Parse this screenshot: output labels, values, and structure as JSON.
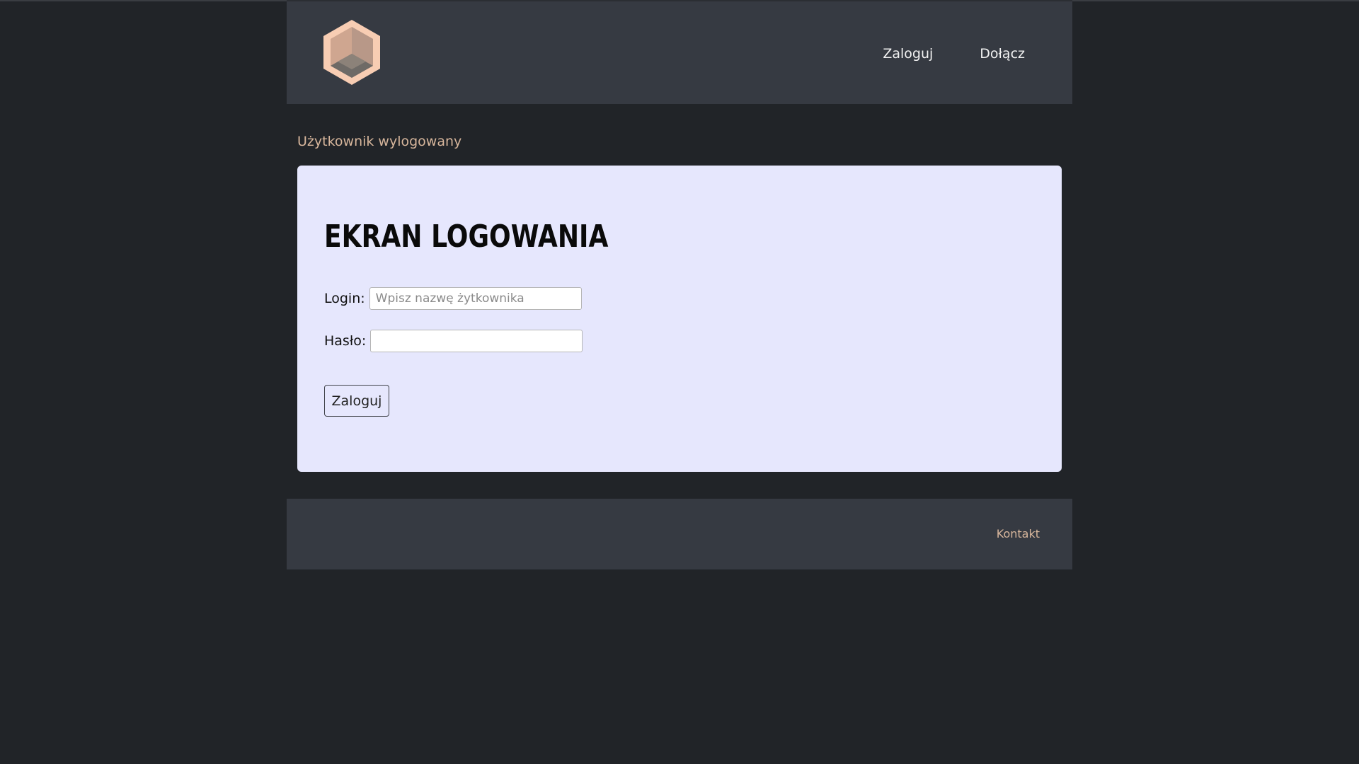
{
  "header": {
    "logo_icon": "hexagon-cube-logo-icon",
    "nav": {
      "login_label": "Zaloguj",
      "join_label": "Dołącz"
    }
  },
  "status": {
    "text": "Użytkownik wylogowany"
  },
  "login_form": {
    "title": "EKRAN LOGOWANIA",
    "login_label": "Login:",
    "login_placeholder": "Wpisz nazwę żytkownika",
    "login_value": "",
    "password_label": "Hasło:",
    "password_value": "",
    "submit_label": "Zaloguj"
  },
  "footer": {
    "contact_label": "Kontakt"
  },
  "colors": {
    "background": "#212428",
    "header_bg": "#363a42",
    "card_bg": "#e6e7fd",
    "accent": "#d7b69c",
    "logo_peach": "#f8cdb3"
  }
}
